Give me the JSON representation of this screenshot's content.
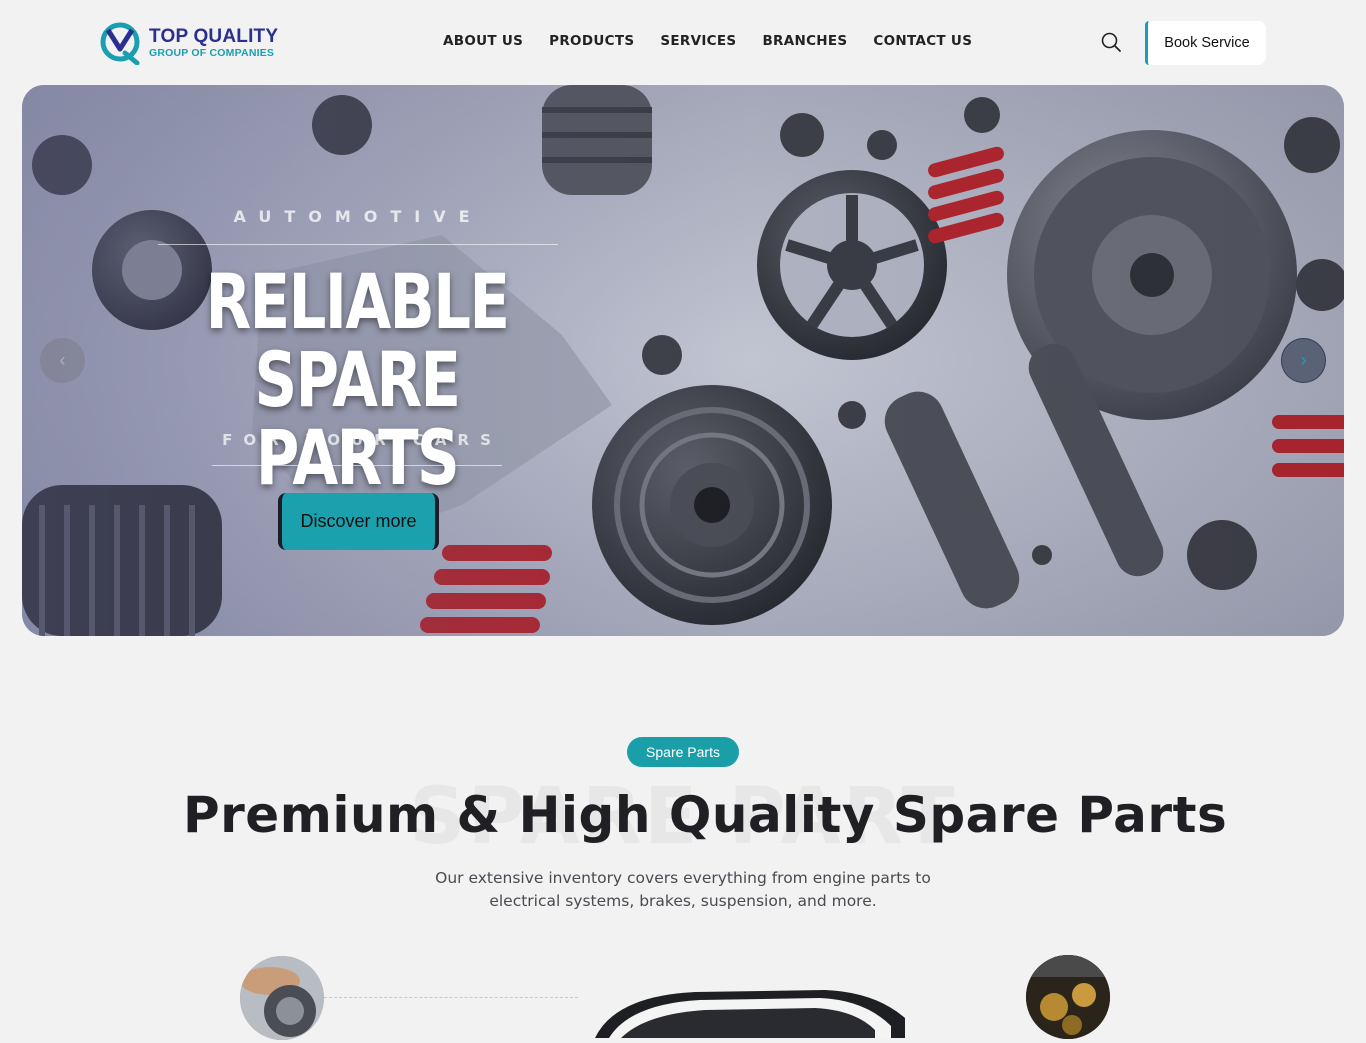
{
  "header": {
    "logo": {
      "title": "TOP QUALITY",
      "subtitle": "GROUP OF COMPANIES",
      "brand_color": "#2b2f8f",
      "accent_color": "#1a9fb0"
    },
    "nav": [
      {
        "label": "ABOUT US"
      },
      {
        "label": "PRODUCTS"
      },
      {
        "label": "SERVICES"
      },
      {
        "label": "BRANCHES"
      },
      {
        "label": "CONTACT US"
      }
    ],
    "search_icon": "search-icon",
    "book_button": "Book Service"
  },
  "hero": {
    "kicker": "AUTOMOTIVE",
    "title_line1": "RELIABLE",
    "title_line2": "SPARE PARTS",
    "subtitle": "FOR YOUR CARS",
    "cta": "Discover more",
    "prev_icon": "chevron-left-icon",
    "next_icon": "chevron-right-icon",
    "accent_color": "#1aa1ad"
  },
  "section": {
    "pill": "Spare Parts",
    "watermark": "SPARE PART",
    "title": "Premium & High Quality Spare Parts",
    "description": "Our extensive inventory covers everything from engine parts to electrical systems, brakes, suspension, and more."
  }
}
